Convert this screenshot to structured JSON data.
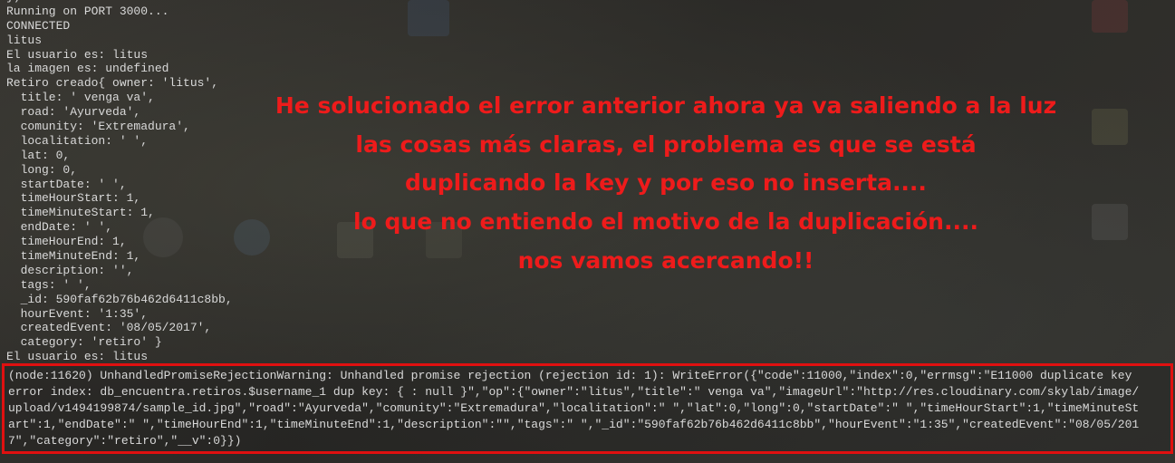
{
  "console": {
    "lines": [
      "})",
      "Running on PORT 3000...",
      "CONNECTED",
      "litus",
      "El usuario es: litus",
      "la imagen es: undefined",
      "Retiro creado{ owner: 'litus',",
      "  title: ' venga va',",
      "  road: 'Ayurveda',",
      "  comunity: 'Extremadura',",
      "  localitation: ' ',",
      "  lat: 0,",
      "  long: 0,",
      "  startDate: ' ',",
      "  timeHourStart: 1,",
      "  timeMinuteStart: 1,",
      "  endDate: ' ',",
      "  timeHourEnd: 1,",
      "  timeMinuteEnd: 1,",
      "  description: '',",
      "  tags: ' ',",
      "  _id: 590faf62b76b462d6411c8bb,",
      "  hourEvent: '1:35',",
      "  createdEvent: '08/05/2017',",
      "  category: 'retiro' }",
      "El usuario es: litus"
    ],
    "error_lines": [
      "(node:11620) UnhandledPromiseRejectionWarning: Unhandled promise rejection (rejection id: 1): WriteError({\"code\":11000,\"index\":0,\"errmsg\":\"E11000 duplicate key",
      "error index: db_encuentra.retiros.$username_1 dup key: { : null }\",\"op\":{\"owner\":\"litus\",\"title\":\" venga va\",\"imageUrl\":\"http://res.cloudinary.com/skylab/image/",
      "upload/v1494199874/sample_id.jpg\",\"road\":\"Ayurveda\",\"comunity\":\"Extremadura\",\"localitation\":\" \",\"lat\":0,\"long\":0,\"startDate\":\" \",\"timeHourStart\":1,\"timeMinuteSt",
      "art\":1,\"endDate\":\" \",\"timeHourEnd\":1,\"timeMinuteEnd\":1,\"description\":\"\",\"tags\":\" \",\"_id\":\"590faf62b76b462d6411c8bb\",\"hourEvent\":\"1:35\",\"createdEvent\":\"08/05/201",
      "7\",\"category\":\"retiro\",\"__v\":0}})"
    ]
  },
  "annotation": {
    "lines": [
      "He solucionado el error anterior ahora ya va saliendo a la luz",
      "las cosas más claras, el problema es que se está",
      "duplicando la key y por eso no inserta....",
      "lo que no entiendo el motivo de la duplicación....",
      "nos vamos acercando!!"
    ]
  },
  "colors": {
    "background": "#2f2d2a",
    "console_text": "#d9d9d9",
    "annotation_text": "#ee1b1b",
    "highlight_border": "#e01010"
  }
}
